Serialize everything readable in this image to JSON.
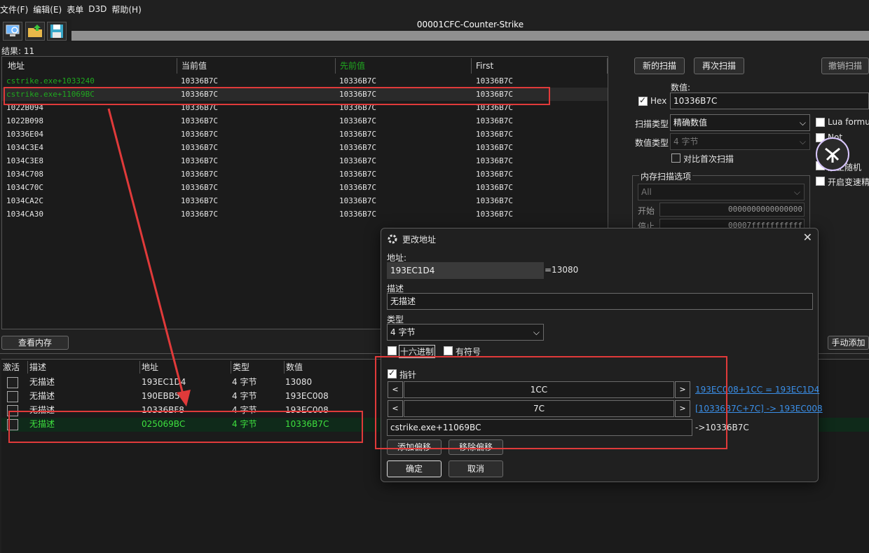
{
  "menu": [
    "文件(F)",
    "编辑(E)",
    "表单",
    "D3D",
    "帮助(H)"
  ],
  "process_title": "00001CFC-Counter-Strike",
  "results_label": "结果: 11",
  "results": {
    "headers": [
      "地址",
      "当前值",
      "先前值",
      "First"
    ],
    "rows": [
      {
        "addr": "cstrike.exe+1033240",
        "cur": "10336B7C",
        "prev": "10336B7C",
        "first": "10336B7C"
      },
      {
        "addr": "cstrike.exe+11069BC",
        "cur": "10336B7C",
        "prev": "10336B7C",
        "first": "10336B7C"
      },
      {
        "addr": "1022B094",
        "cur": "10336B7C",
        "prev": "10336B7C",
        "first": "10336B7C"
      },
      {
        "addr": "1022B098",
        "cur": "10336B7C",
        "prev": "10336B7C",
        "first": "10336B7C"
      },
      {
        "addr": "10336E04",
        "cur": "10336B7C",
        "prev": "10336B7C",
        "first": "10336B7C"
      },
      {
        "addr": "1034C3E4",
        "cur": "10336B7C",
        "prev": "10336B7C",
        "first": "10336B7C"
      },
      {
        "addr": "1034C3E8",
        "cur": "10336B7C",
        "prev": "10336B7C",
        "first": "10336B7C"
      },
      {
        "addr": "1034C708",
        "cur": "10336B7C",
        "prev": "10336B7C",
        "first": "10336B7C"
      },
      {
        "addr": "1034C70C",
        "cur": "10336B7C",
        "prev": "10336B7C",
        "first": "10336B7C"
      },
      {
        "addr": "1034CA2C",
        "cur": "10336B7C",
        "prev": "10336B7C",
        "first": "10336B7C"
      },
      {
        "addr": "1034CA30",
        "cur": "10336B7C",
        "prev": "10336B7C",
        "first": "10336B7C"
      }
    ]
  },
  "scan": {
    "new_scan": "新的扫描",
    "next_scan": "再次扫描",
    "undo_scan": "撤销扫描",
    "value_label": "数值:",
    "hex_label": "Hex",
    "value": "10336B7C",
    "scan_type_label": "扫描类型",
    "scan_type": "精确数值",
    "value_type_label": "数值类型",
    "value_type": "4 字节",
    "compare_first": "对比首次扫描",
    "lua_formula": "Lua formu",
    "not_label": "Not",
    "random": "禁止随机",
    "speedhack": "开启变速精",
    "mem_options": "内存扫描选项",
    "mem_region": "All",
    "start_label": "开始",
    "start": "0000000000000000",
    "stop_label": "停止",
    "stop": "00007fffffffffff"
  },
  "view_memory": "查看内存",
  "manual_add": "手动添加",
  "addr_list": {
    "headers": [
      "激活",
      "描述",
      "地址",
      "类型",
      "数值"
    ],
    "rows": [
      {
        "desc": "无描述",
        "addr": "193EC1D4",
        "type": "4 字节",
        "value": "13080"
      },
      {
        "desc": "无描述",
        "addr": "190EBB58",
        "type": "4 字节",
        "value": "193EC008"
      },
      {
        "desc": "无描述",
        "addr": "10336BF8",
        "type": "4 字节",
        "value": "193EC008"
      },
      {
        "desc": "无描述",
        "addr": "025069BC",
        "type": "4 字节",
        "value": "10336B7C"
      }
    ]
  },
  "dialog": {
    "title": "更改地址",
    "addr_label": "地址:",
    "addr": "193EC1D4",
    "addr_eq": "=13080",
    "desc_label": "描述",
    "desc": "无描述",
    "type_label": "类型",
    "type": "4 字节",
    "hex_label": "十六进制",
    "signed_label": "有符号",
    "pointer_label": "指针",
    "offset1": "1CC",
    "offset1_calc": "193EC008+1CC = 193EC1D4",
    "offset2": "7C",
    "offset2_calc": "[10336B7C+7C] -> 193EC008",
    "base": "cstrike.exe+11069BC",
    "base_calc": "->10336B7C",
    "add_offset": "添加偏移",
    "remove_offset": "移除偏移",
    "ok": "确定",
    "cancel": "取消",
    "left_arrow": "<",
    "right_arrow": ">"
  },
  "colors": {
    "green": "#1fa81f",
    "bright_green": "#3ee03e",
    "red": "#e03a3a",
    "link": "#3a8fe8"
  }
}
